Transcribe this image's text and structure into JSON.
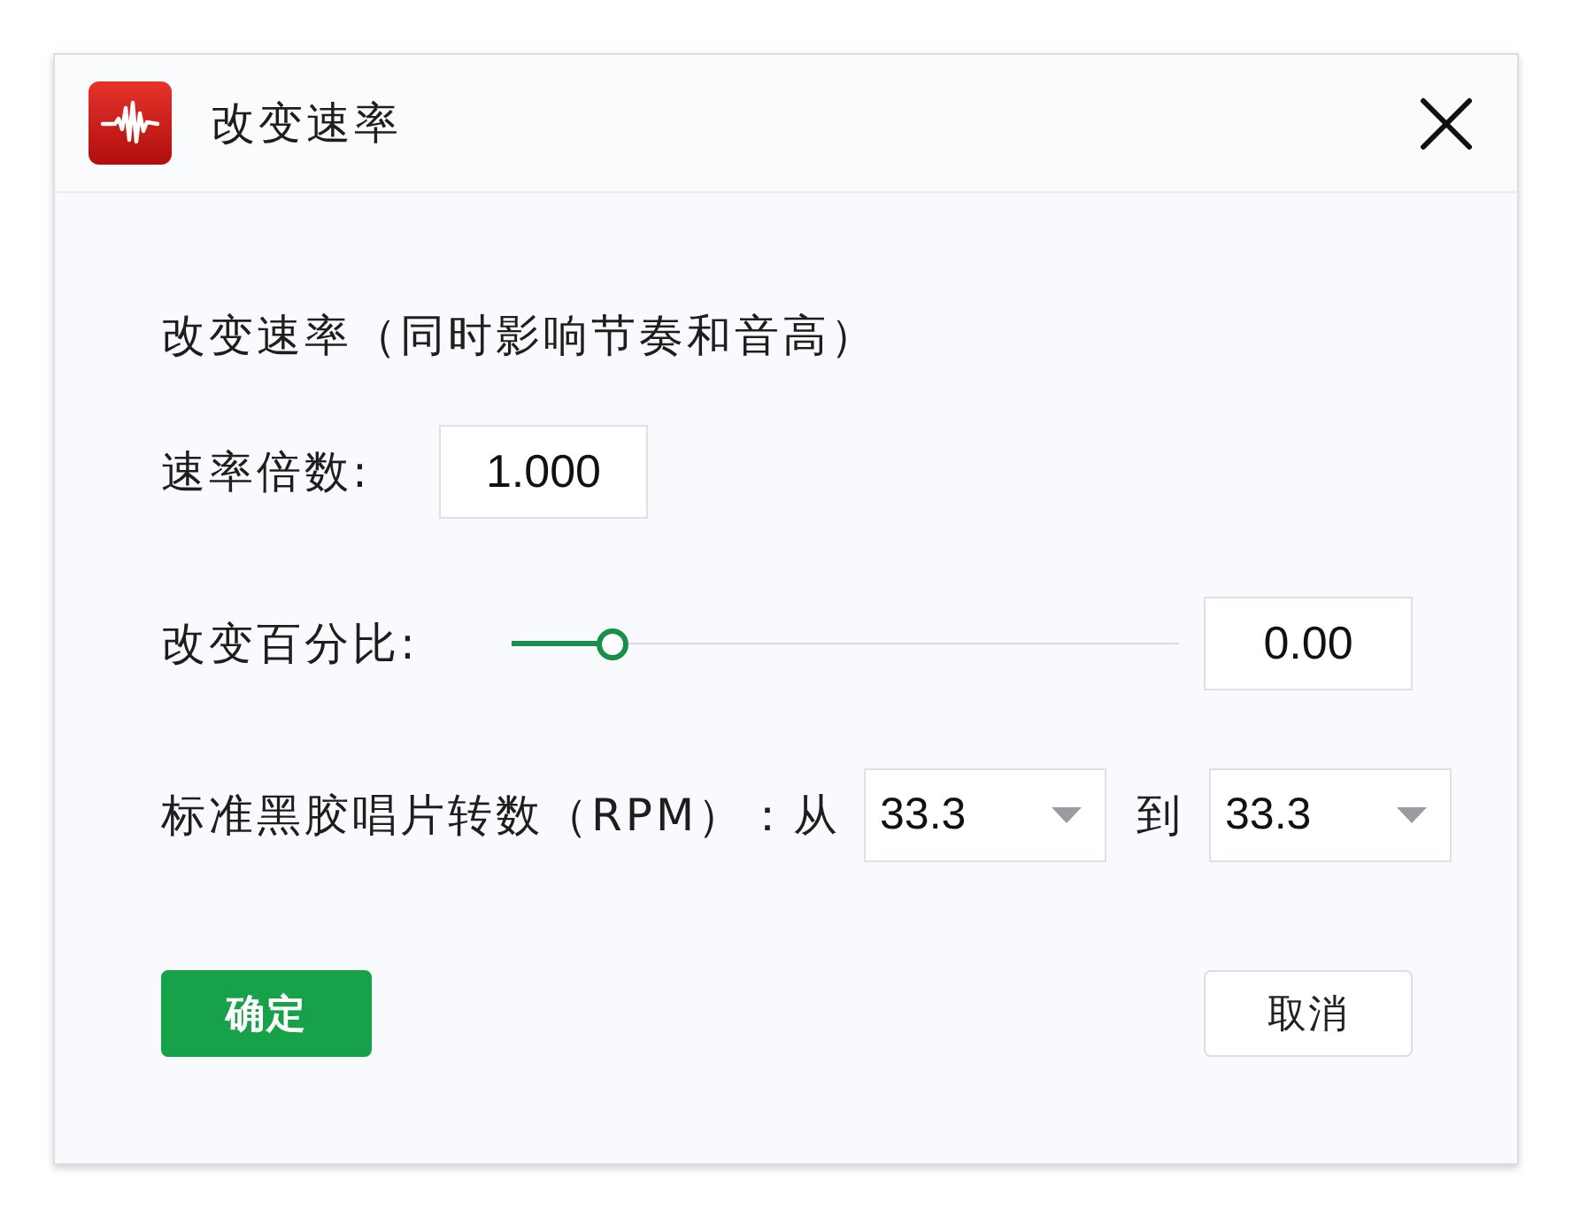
{
  "window": {
    "title": "改变速率"
  },
  "heading": "改变速率（同时影响节奏和音高）",
  "rate": {
    "label": "速率倍数:",
    "value": "1.000"
  },
  "percent": {
    "label": "改变百分比:",
    "level": 0.15,
    "value": "0.00"
  },
  "rpm": {
    "label": "标准黑胶唱片转数（RPM）：",
    "from_label": "从",
    "from_value": "33.3",
    "to_label": "到",
    "to_value": "33.3"
  },
  "buttons": [
    {
      "label": "确定",
      "kind": "primary"
    },
    {
      "label": "取消",
      "kind": "secondary"
    }
  ]
}
